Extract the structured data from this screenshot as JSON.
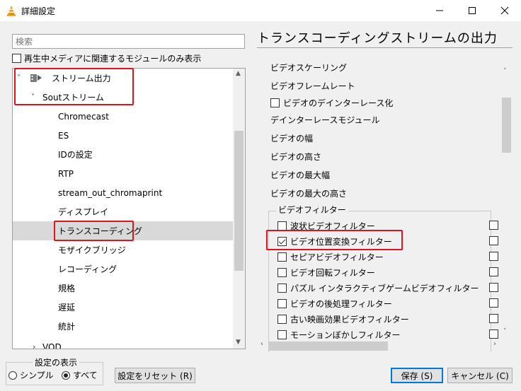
{
  "window": {
    "title": "詳細設定",
    "minimize_icon": "minimize-icon",
    "maximize_icon": "maximize-icon",
    "close_icon": "close-icon"
  },
  "search": {
    "placeholder": "検索"
  },
  "only_current": {
    "label": "再生中メディアに関連するモジュールのみ表示",
    "checked": false
  },
  "tree": {
    "items": [
      {
        "label": "ストリーム出力",
        "level": 0,
        "expanded": true,
        "icon": "stream-output-icon"
      },
      {
        "label": "Soutストリーム",
        "level": 1,
        "expanded": true
      },
      {
        "label": "Chromecast",
        "level": 2
      },
      {
        "label": "ES",
        "level": 2
      },
      {
        "label": "IDの設定",
        "level": 2
      },
      {
        "label": "RTP",
        "level": 2
      },
      {
        "label": "stream_out_chromaprint",
        "level": 2
      },
      {
        "label": "ディスプレイ",
        "level": 2
      },
      {
        "label": "トランスコーディング",
        "level": 2,
        "selected": true
      },
      {
        "label": "モザイクブリッジ",
        "level": 2
      },
      {
        "label": "レコーディング",
        "level": 2
      },
      {
        "label": "規格",
        "level": 2
      },
      {
        "label": "遅延",
        "level": 2
      },
      {
        "label": "統計",
        "level": 2
      },
      {
        "label": "VOD",
        "level": 1,
        "expanded": false
      }
    ]
  },
  "panel": {
    "heading": "トランスコーディングストリームの出力",
    "rows": [
      {
        "label": "ビデオスケーリング",
        "type": "text"
      },
      {
        "label": "ビデオフレームレート",
        "type": "text"
      },
      {
        "label": "ビデオのデインターレース化",
        "type": "checkbox",
        "checked": false
      },
      {
        "label": "デインターレースモジュール",
        "type": "text"
      },
      {
        "label": "ビデオの幅",
        "type": "text"
      },
      {
        "label": "ビデオの高さ",
        "type": "text"
      },
      {
        "label": "ビデオの最大幅",
        "type": "text"
      },
      {
        "label": "ビデオの最大の高さ",
        "type": "text"
      }
    ],
    "filter_group_title": "ビデオフィルター",
    "filters": [
      {
        "label": "波状ビデオフィルター",
        "checked": false
      },
      {
        "label": "ビデオ位置変換フィルター",
        "checked": true
      },
      {
        "label": "セピアビデオフィルター",
        "checked": false
      },
      {
        "label": "ビデオ回転フィルター",
        "checked": false
      },
      {
        "label": "パズル インタラクティブゲームビデオフィルター",
        "checked": false
      },
      {
        "label": "ビデオの後処理フィルター",
        "checked": false
      },
      {
        "label": "古い映画効果ビデオフィルター",
        "checked": false
      },
      {
        "label": "モーションぼかしフィルター",
        "checked": false
      }
    ]
  },
  "bottom": {
    "settings_group_title": "設定の表示",
    "radio_simple": "シンプル",
    "radio_all": "すべて",
    "selected_view": "すべて",
    "reset_button": "設定をリセット (R)",
    "save_button": "保存 (S)",
    "cancel_button": "キャンセル (C)"
  },
  "colors": {
    "highlight": "#e0121c",
    "selection": "#d9d9d9",
    "accent": "#0078d7"
  }
}
